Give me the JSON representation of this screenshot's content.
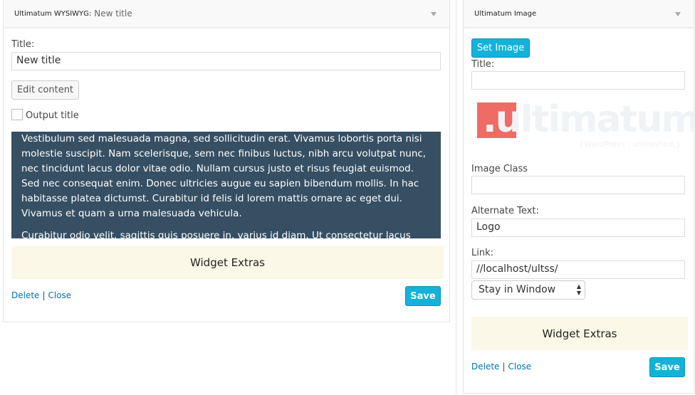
{
  "left": {
    "header_title": "Ultimatum WYSIWYG:",
    "header_subtitle": "New title",
    "title_label": "Title:",
    "title_value": "New title",
    "edit_content": "Edit content",
    "output_title": "Output title",
    "content_paragraphs": [
      "Vestibulum sed malesuada magna, sed sollicitudin erat. Vivamus lobortis porta nisi molestie suscipit. Nam scelerisque, sem nec finibus luctus, nibh arcu volutpat nunc, nec tincidunt lacus dolor vitae odio. Nullam cursus justo et risus feugiat euismod. Sed nec consequat enim. Donec ultricies augue eu sapien bibendum mollis. In hac habitasse platea dictumst. Curabitur id felis id lorem mattis ornare ac eget dui. Vivamus et quam a urna malesuada vehicula.",
      "Curabitur odio velit, sagittis quis posuere in, varius id diam. Ut consectetur lacus massa, vel"
    ],
    "widget_extras": "Widget Extras",
    "delete": "Delete",
    "sep": "|",
    "close": "Close",
    "save": "Save"
  },
  "right": {
    "header_title": "Ultimatum Image",
    "set_image": "Set Image",
    "title_label": "Title:",
    "title_value": "",
    "logo_text": "Ultimatum",
    "logo_tagline": "{WordPress : unleashed;}",
    "image_class_label": "Image Class",
    "image_class_value": "",
    "alt_label": "Alternate Text:",
    "alt_value": "Logo",
    "link_label": "Link:",
    "link_value": "//localhost/ultss/",
    "window_select": "Stay in Window",
    "widget_extras": "Widget Extras",
    "delete": "Delete",
    "sep": "|",
    "close": "Close",
    "save": "Save"
  },
  "colors": {
    "accent": "#14b2d9",
    "content_bg": "#364f63",
    "extras_bg": "#fcf8e7",
    "logo_red": "#ee6b66"
  }
}
